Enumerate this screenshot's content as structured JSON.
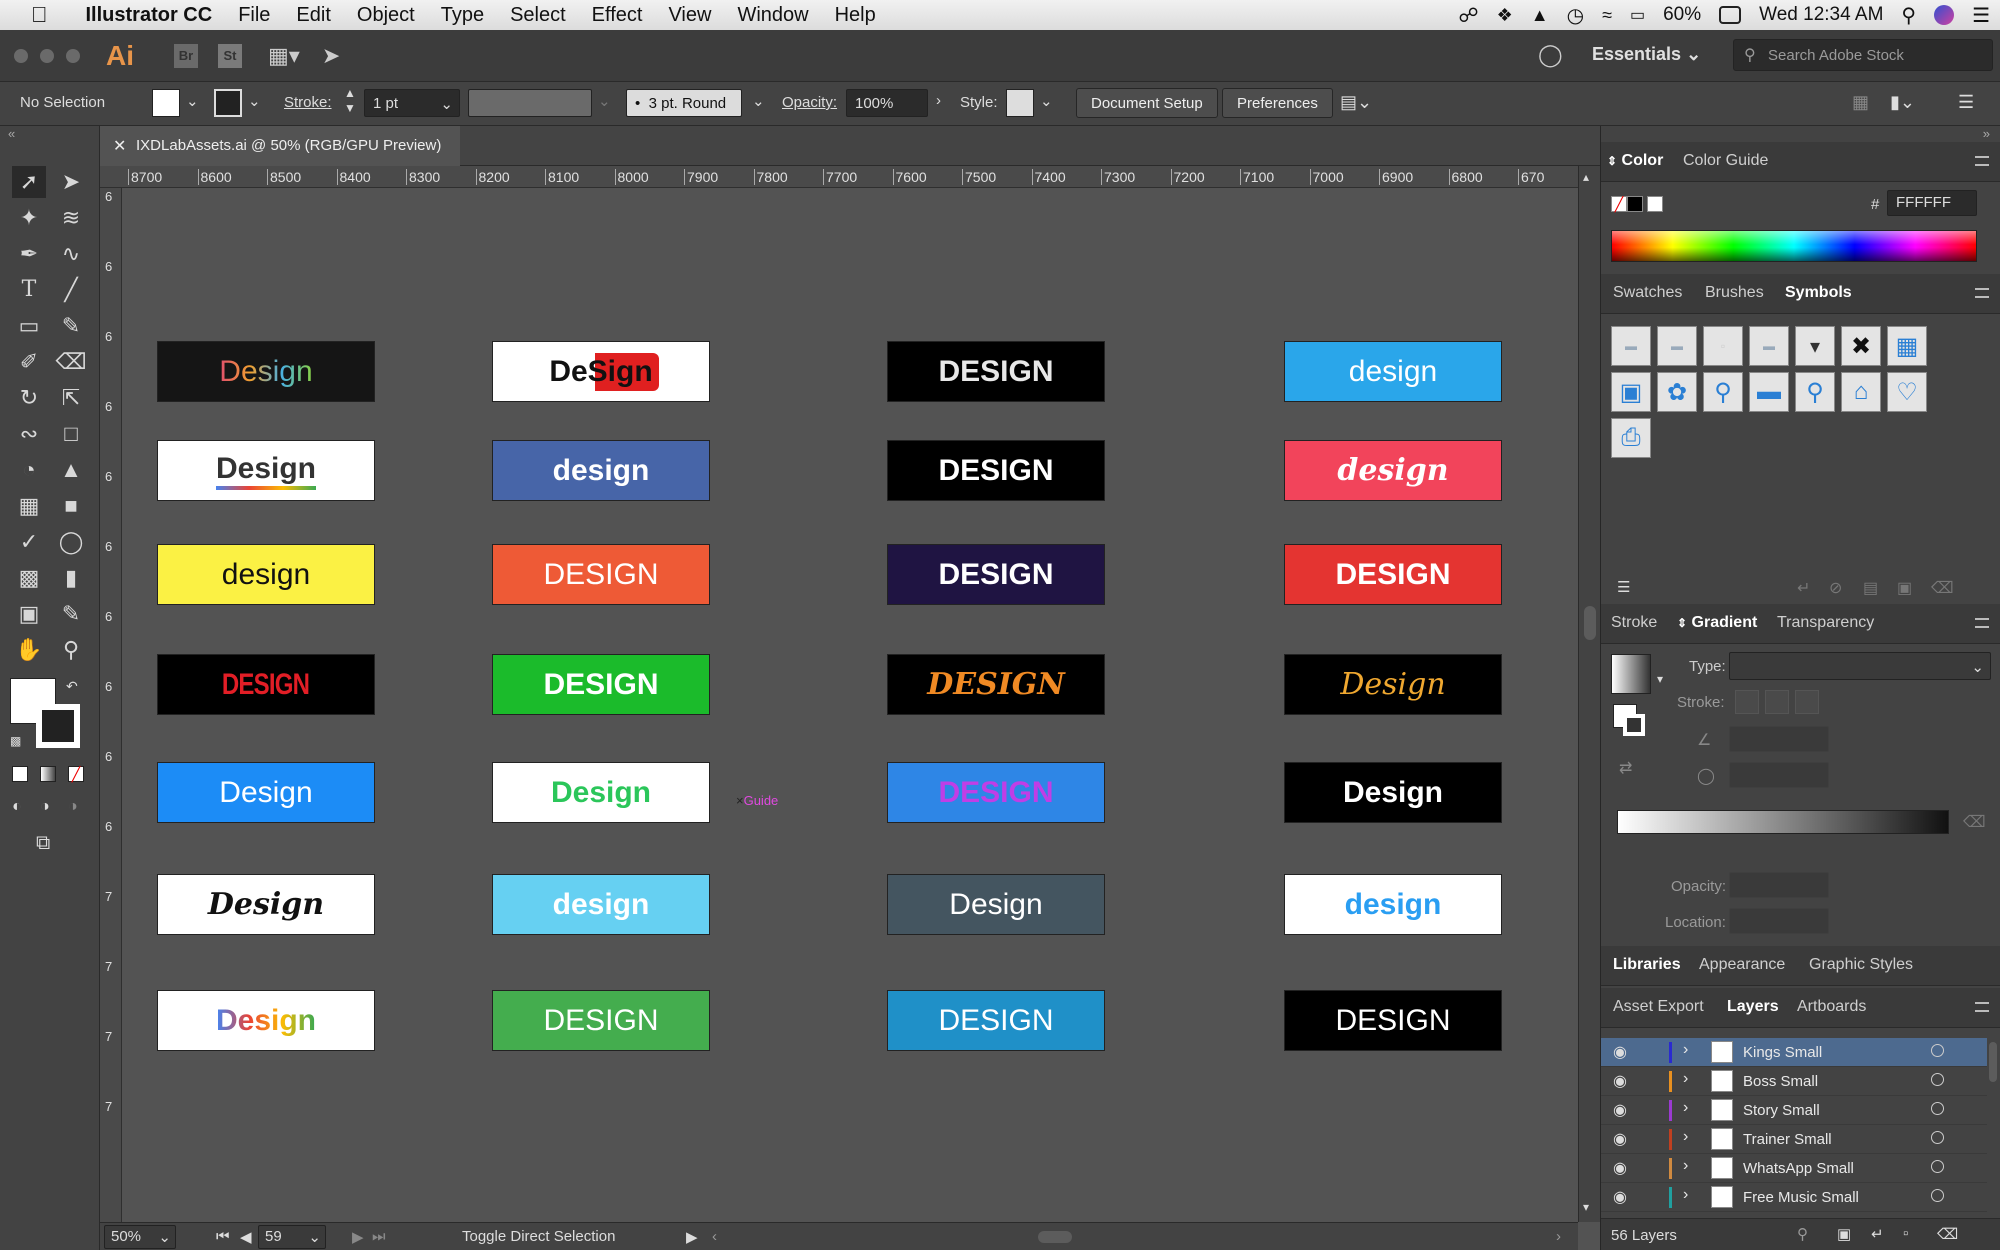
{
  "menubar": {
    "app": "Illustrator CC",
    "items": [
      "File",
      "Edit",
      "Object",
      "Type",
      "Select",
      "Effect",
      "View",
      "Window",
      "Help"
    ],
    "battery": "60%",
    "clock": "Wed 12:34 AM"
  },
  "appbar": {
    "logo": "Ai",
    "bridge": "Br",
    "stock": "St",
    "workspace": "Essentials",
    "search_placeholder": "Search Adobe Stock"
  },
  "control": {
    "selection": "No Selection",
    "stroke_label": "Stroke:",
    "stroke_value": "1 pt",
    "brush": "3 pt. Round",
    "opacity_label": "Opacity:",
    "opacity_value": "100%",
    "style_label": "Style:",
    "doc_setup": "Document Setup",
    "preferences": "Preferences"
  },
  "document": {
    "tab_title": "IXDLabAssets.ai @ 50% (RGB/GPU Preview)"
  },
  "rulers": {
    "h": [
      "8700",
      "8600",
      "8500",
      "8400",
      "8300",
      "8200",
      "8100",
      "8000",
      "7900",
      "7800",
      "7700",
      "7600",
      "7500",
      "7400",
      "7300",
      "7200",
      "7100",
      "7000",
      "6900",
      "6800",
      "670"
    ],
    "v": [
      "6",
      "6",
      "6",
      "6",
      "6",
      "6",
      "6",
      "6",
      "6",
      "6",
      "7",
      "7",
      "7",
      "7"
    ]
  },
  "canvas": {
    "guide_label": "Guide",
    "cards": [
      {
        "text": "Design",
        "bg": "#151515",
        "fg": "#e05a7a",
        "style": "multicolor"
      },
      {
        "text": "DeSign",
        "bg": "#ffffff",
        "fg": "#111111",
        "style": "youtube"
      },
      {
        "text": "DESIGN",
        "bg": "#000000",
        "fg": "#e8e8e8",
        "style": "bold"
      },
      {
        "text": "design",
        "bg": "#2aa6ea",
        "fg": "#ffffff",
        "style": "normal"
      },
      {
        "text": "Design",
        "bg": "#ffffff",
        "fg": "#333333",
        "style": "google"
      },
      {
        "text": "design",
        "bg": "#4765a8",
        "fg": "#ffffff",
        "style": "bold"
      },
      {
        "text": "DESIGN",
        "bg": "#000000",
        "fg": "#ffffff",
        "style": "bold"
      },
      {
        "text": "design",
        "bg": "#f2445b",
        "fg": "#ffffff",
        "style": "script"
      },
      {
        "text": "design",
        "bg": "#fbf144",
        "fg": "#111111",
        "style": "normal"
      },
      {
        "text": "DESIGN",
        "bg": "#ee5a36",
        "fg": "#ffffff",
        "style": "light"
      },
      {
        "text": "DESIGN",
        "bg": "#1f1442",
        "fg": "#ffffff",
        "style": "bold"
      },
      {
        "text": "DESIGN",
        "bg": "#e43431",
        "fg": "#ffffff",
        "style": "bold"
      },
      {
        "text": "DESIGN",
        "bg": "#000000",
        "fg": "#e21e26",
        "style": "condensed"
      },
      {
        "text": "DESIGN",
        "bg": "#1bbb2b",
        "fg": "#ffffff",
        "style": "bold"
      },
      {
        "text": "DESIGN",
        "bg": "#000000",
        "fg": "#f08a24",
        "style": "italic"
      },
      {
        "text": "Design",
        "bg": "#000000",
        "fg": "#f0a830",
        "style": "serif"
      },
      {
        "text": "Design",
        "bg": "#1c8cf6",
        "fg": "#ffffff",
        "style": "light"
      },
      {
        "text": "Design",
        "bg": "#ffffff",
        "fg": "#2bc65a",
        "style": "bold"
      },
      {
        "text": "DESIGN",
        "bg": "#2e86e6",
        "fg": "#c03ee6",
        "style": "bold"
      },
      {
        "text": "Design",
        "bg": "#000000",
        "fg": "#ffffff",
        "style": "bold"
      },
      {
        "text": "Design",
        "bg": "#ffffff",
        "fg": "#111111",
        "style": "script"
      },
      {
        "text": "design",
        "bg": "#66d0f2",
        "fg": "#ffffff",
        "style": "bold"
      },
      {
        "text": "Design",
        "bg": "#445560",
        "fg": "#ffffff",
        "style": "normal"
      },
      {
        "text": "design",
        "bg": "#ffffff",
        "fg": "#2a9ef2",
        "style": "bold"
      },
      {
        "text": "Design",
        "bg": "#ffffff",
        "fg": "#4285f4",
        "style": "google"
      },
      {
        "text": "DESIGN",
        "bg": "#44ad4e",
        "fg": "#ffffff",
        "style": "normal"
      },
      {
        "text": "DESIGN",
        "bg": "#1f90c8",
        "fg": "#ffffff",
        "style": "normal"
      },
      {
        "text": "DESIGN",
        "bg": "#000000",
        "fg": "#ffffff",
        "style": "normal"
      }
    ]
  },
  "status": {
    "zoom": "50%",
    "artboard": "59",
    "tool": "Toggle Direct Selection"
  },
  "panels": {
    "color_tabs": [
      "Color",
      "Color Guide"
    ],
    "hex_label": "#",
    "hex": "FFFFFF",
    "swatch_tabs": [
      "Swatches",
      "Brushes",
      "Symbols"
    ],
    "gradient_tabs": [
      "Stroke",
      "Gradient",
      "Transparency"
    ],
    "gradient_type_label": "Type:",
    "gradient_stroke_label": "Stroke:",
    "gradient_opacity_label": "Opacity:",
    "gradient_location_label": "Location:",
    "library_tabs": [
      "Libraries",
      "Appearance",
      "Graphic Styles"
    ],
    "layer_tabs": [
      "Asset Export",
      "Layers",
      "Artboards"
    ],
    "layers": [
      {
        "name": "Kings Small",
        "color": "#2a2ad0"
      },
      {
        "name": "Boss Small",
        "color": "#e89020"
      },
      {
        "name": "Story Small",
        "color": "#9a3ad0"
      },
      {
        "name": "Trainer Small",
        "color": "#c04020"
      },
      {
        "name": "WhatsApp Small",
        "color": "#d08a40"
      },
      {
        "name": "Free Music Small",
        "color": "#20a0a0"
      }
    ],
    "layer_count": "56 Layers"
  }
}
